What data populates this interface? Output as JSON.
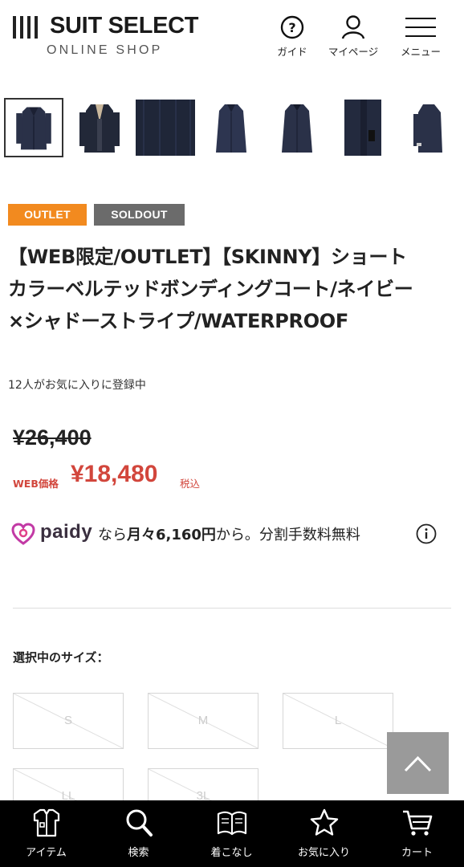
{
  "header": {
    "logo_name": "SUIT SELECT",
    "logo_sub": "ONLINE SHOP",
    "nav": [
      {
        "label": "ガイド",
        "icon": "help-circle-icon"
      },
      {
        "label": "マイページ",
        "icon": "user-icon"
      },
      {
        "label": "メニュー",
        "icon": "hamburger-menu-icon"
      }
    ]
  },
  "thumbnails": [
    {
      "alt": "coat front",
      "selected": true
    },
    {
      "alt": "coat open",
      "selected": false
    },
    {
      "alt": "fabric closeup",
      "selected": false
    },
    {
      "alt": "coat front 2",
      "selected": false
    },
    {
      "alt": "coat front 3",
      "selected": false
    },
    {
      "alt": "coat detail",
      "selected": false
    },
    {
      "alt": "coat side",
      "selected": false
    }
  ],
  "badges": {
    "outlet": "OUTLET",
    "soldout": "SOLDOUT"
  },
  "product": {
    "title_line1": "【WEB限定/OUTLET】【SKINNY】ショート",
    "title_line2": "カラーベルテッドボンディングコート/ネイビー",
    "title_line3": "×シャドーストライプ/WATERPROOF",
    "favorites": "12人がお気に入りに登録中",
    "old_price": "¥26,400",
    "price_label": "WEB価格",
    "price": "¥18,480",
    "tax": "税込"
  },
  "paidy": {
    "brand": "paidy",
    "text_pre": "なら",
    "text_bold": "月々6,160円",
    "text_post": "から。分割手数料無料"
  },
  "size": {
    "label": "選択中のサイズ：",
    "options": [
      "S",
      "M",
      "L",
      "LL",
      "3L"
    ]
  },
  "bottom_nav": [
    {
      "label": "アイテム",
      "icon": "shirt-icon"
    },
    {
      "label": "検索",
      "icon": "search-icon"
    },
    {
      "label": "着こなし",
      "icon": "book-icon"
    },
    {
      "label": "お気に入り",
      "icon": "star-icon"
    },
    {
      "label": "カート",
      "icon": "cart-icon"
    }
  ],
  "colors": {
    "outlet": "#f28a1f",
    "soldout": "#6b6b6b",
    "price": "#d2463c",
    "coat": "#2a3148"
  }
}
